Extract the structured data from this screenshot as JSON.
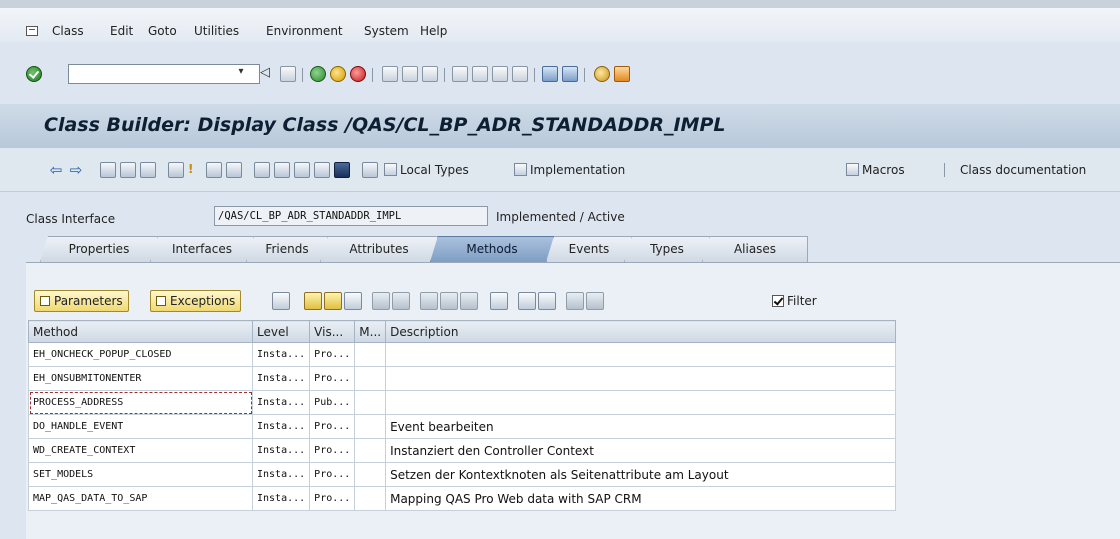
{
  "menu": [
    "Class",
    "Edit",
    "Goto",
    "Utilities",
    "Environment",
    "System",
    "Help"
  ],
  "toolbar": {
    "command_value": "",
    "dropdown_glyph": "▾"
  },
  "title": "Class Builder: Display Class /QAS/CL_BP_ADR_STANDADDR_IMPL",
  "app_toolbar": {
    "local_types": "Local Types",
    "implementation": "Implementation",
    "macros": "Macros",
    "class_documentation": "Class documentation"
  },
  "class_interface": {
    "label": "Class Interface",
    "value": "/QAS/CL_BP_ADR_STANDADDR_IMPL",
    "status": "Implemented / Active"
  },
  "tabs": [
    "Properties",
    "Interfaces",
    "Friends",
    "Attributes",
    "Methods",
    "Events",
    "Types",
    "Aliases"
  ],
  "active_tab": "Methods",
  "table_toolbar": {
    "parameters": "Parameters",
    "exceptions": "Exceptions",
    "filter": "Filter"
  },
  "table": {
    "headers": [
      "Method",
      "Level",
      "Vis...",
      "M...",
      "Description"
    ],
    "rows": [
      [
        "EH_ONCHECK_POPUP_CLOSED",
        "Insta...",
        "Pro...",
        "",
        ""
      ],
      [
        "EH_ONSUBMITONENTER",
        "Insta...",
        "Pro...",
        "",
        ""
      ],
      [
        "PROCESS_ADDRESS",
        "Insta...",
        "Pub...",
        "",
        ""
      ],
      [
        "DO_HANDLE_EVENT",
        "Insta...",
        "Pro...",
        "",
        "Event bearbeiten"
      ],
      [
        "WD_CREATE_CONTEXT",
        "Insta...",
        "Pro...",
        "",
        "Instanziert den Controller Context"
      ],
      [
        "SET_MODELS",
        "Insta...",
        "Pro...",
        "",
        "Setzen der Kontextknoten als Seitenattribute am Layout"
      ],
      [
        "MAP_QAS_DATA_TO_SAP",
        "Insta...",
        "Pro...",
        "",
        "Mapping QAS Pro Web data with SAP CRM"
      ]
    ]
  }
}
